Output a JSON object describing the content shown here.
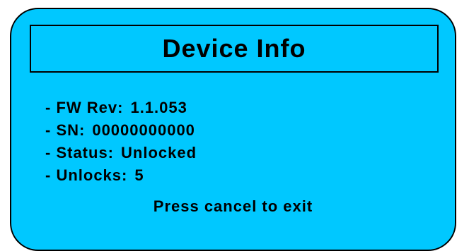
{
  "screen": {
    "title": "Device Info",
    "info": [
      {
        "label": "- FW Rev:",
        "value": "1.1.053"
      },
      {
        "label": "- SN:",
        "value": "00000000000"
      },
      {
        "label": "- Status:",
        "value": "Unlocked"
      },
      {
        "label": "- Unlocks:",
        "value": "5"
      }
    ],
    "footer": "Press cancel to exit"
  },
  "colors": {
    "screen_background": "#00c8ff",
    "border": "#000000",
    "text": "#000000"
  }
}
